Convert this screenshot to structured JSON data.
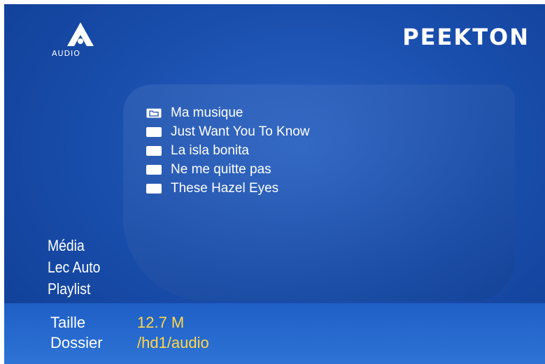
{
  "brand": "PEEKTON",
  "logo_text": "AUDIO",
  "file_list": [
    {
      "label": "Ma musique",
      "icon": "folder-icon"
    },
    {
      "label": "Just Want You To Know",
      "icon": "file-icon"
    },
    {
      "label": "La isla bonita",
      "icon": "file-icon"
    },
    {
      "label": "Ne me quitte pas",
      "icon": "file-icon"
    },
    {
      "label": "These Hazel Eyes",
      "icon": "file-icon"
    }
  ],
  "side_menu": [
    {
      "label": "Média"
    },
    {
      "label": "Lec Auto"
    },
    {
      "label": "Playlist"
    }
  ],
  "info": {
    "size_label": "Taille",
    "size_value": "12.7 M",
    "folder_label": "Dossier",
    "folder_value": "/hd1/audio"
  },
  "colors": {
    "background": "#1a4fae",
    "text": "#ffffff",
    "value_text": "#ffd84a"
  }
}
